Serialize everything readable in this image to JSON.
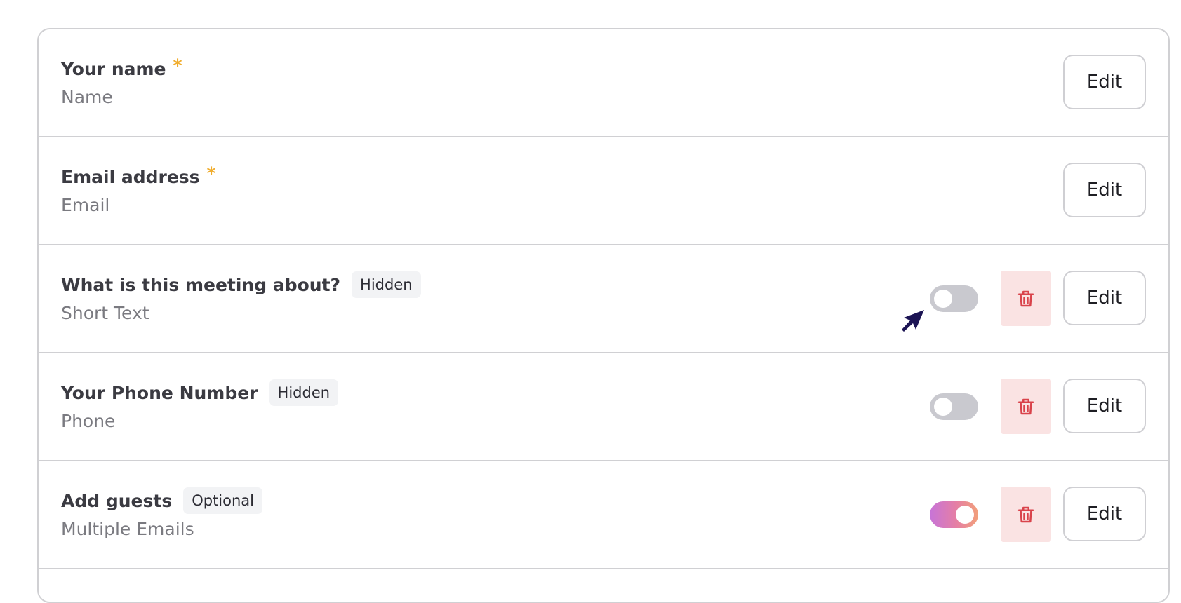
{
  "fields": [
    {
      "title": "Your name",
      "required_mark": "*",
      "tag": "",
      "subtitle": "Name",
      "edit_label": "Edit",
      "has_toggle": false
    },
    {
      "title": "Email address",
      "required_mark": "*",
      "tag": "",
      "subtitle": "Email",
      "edit_label": "Edit",
      "has_toggle": false
    },
    {
      "title": "What is this meeting about?",
      "required_mark": "",
      "tag": "Hidden",
      "subtitle": "Short Text",
      "edit_label": "Edit",
      "has_toggle": true,
      "toggle_on": false
    },
    {
      "title": "Your Phone Number",
      "required_mark": "",
      "tag": "Hidden",
      "subtitle": "Phone",
      "edit_label": "Edit",
      "has_toggle": true,
      "toggle_on": false
    },
    {
      "title": "Add guests",
      "required_mark": "",
      "tag": "Optional",
      "subtitle": "Multiple Emails",
      "edit_label": "Edit",
      "has_toggle": true,
      "toggle_on": true
    }
  ],
  "icons": {
    "delete": "trash-icon",
    "cursor": "mouse-pointer-icon"
  },
  "colors": {
    "required": "#f0ad2e",
    "delete_bg": "#fae3e3",
    "delete_icon": "#d9434b",
    "toggle_off": "#c9c9cf",
    "toggle_on_gradient": [
      "#c774d8",
      "#e57fa4",
      "#f2a07a"
    ],
    "cursor": "#1c1454"
  }
}
